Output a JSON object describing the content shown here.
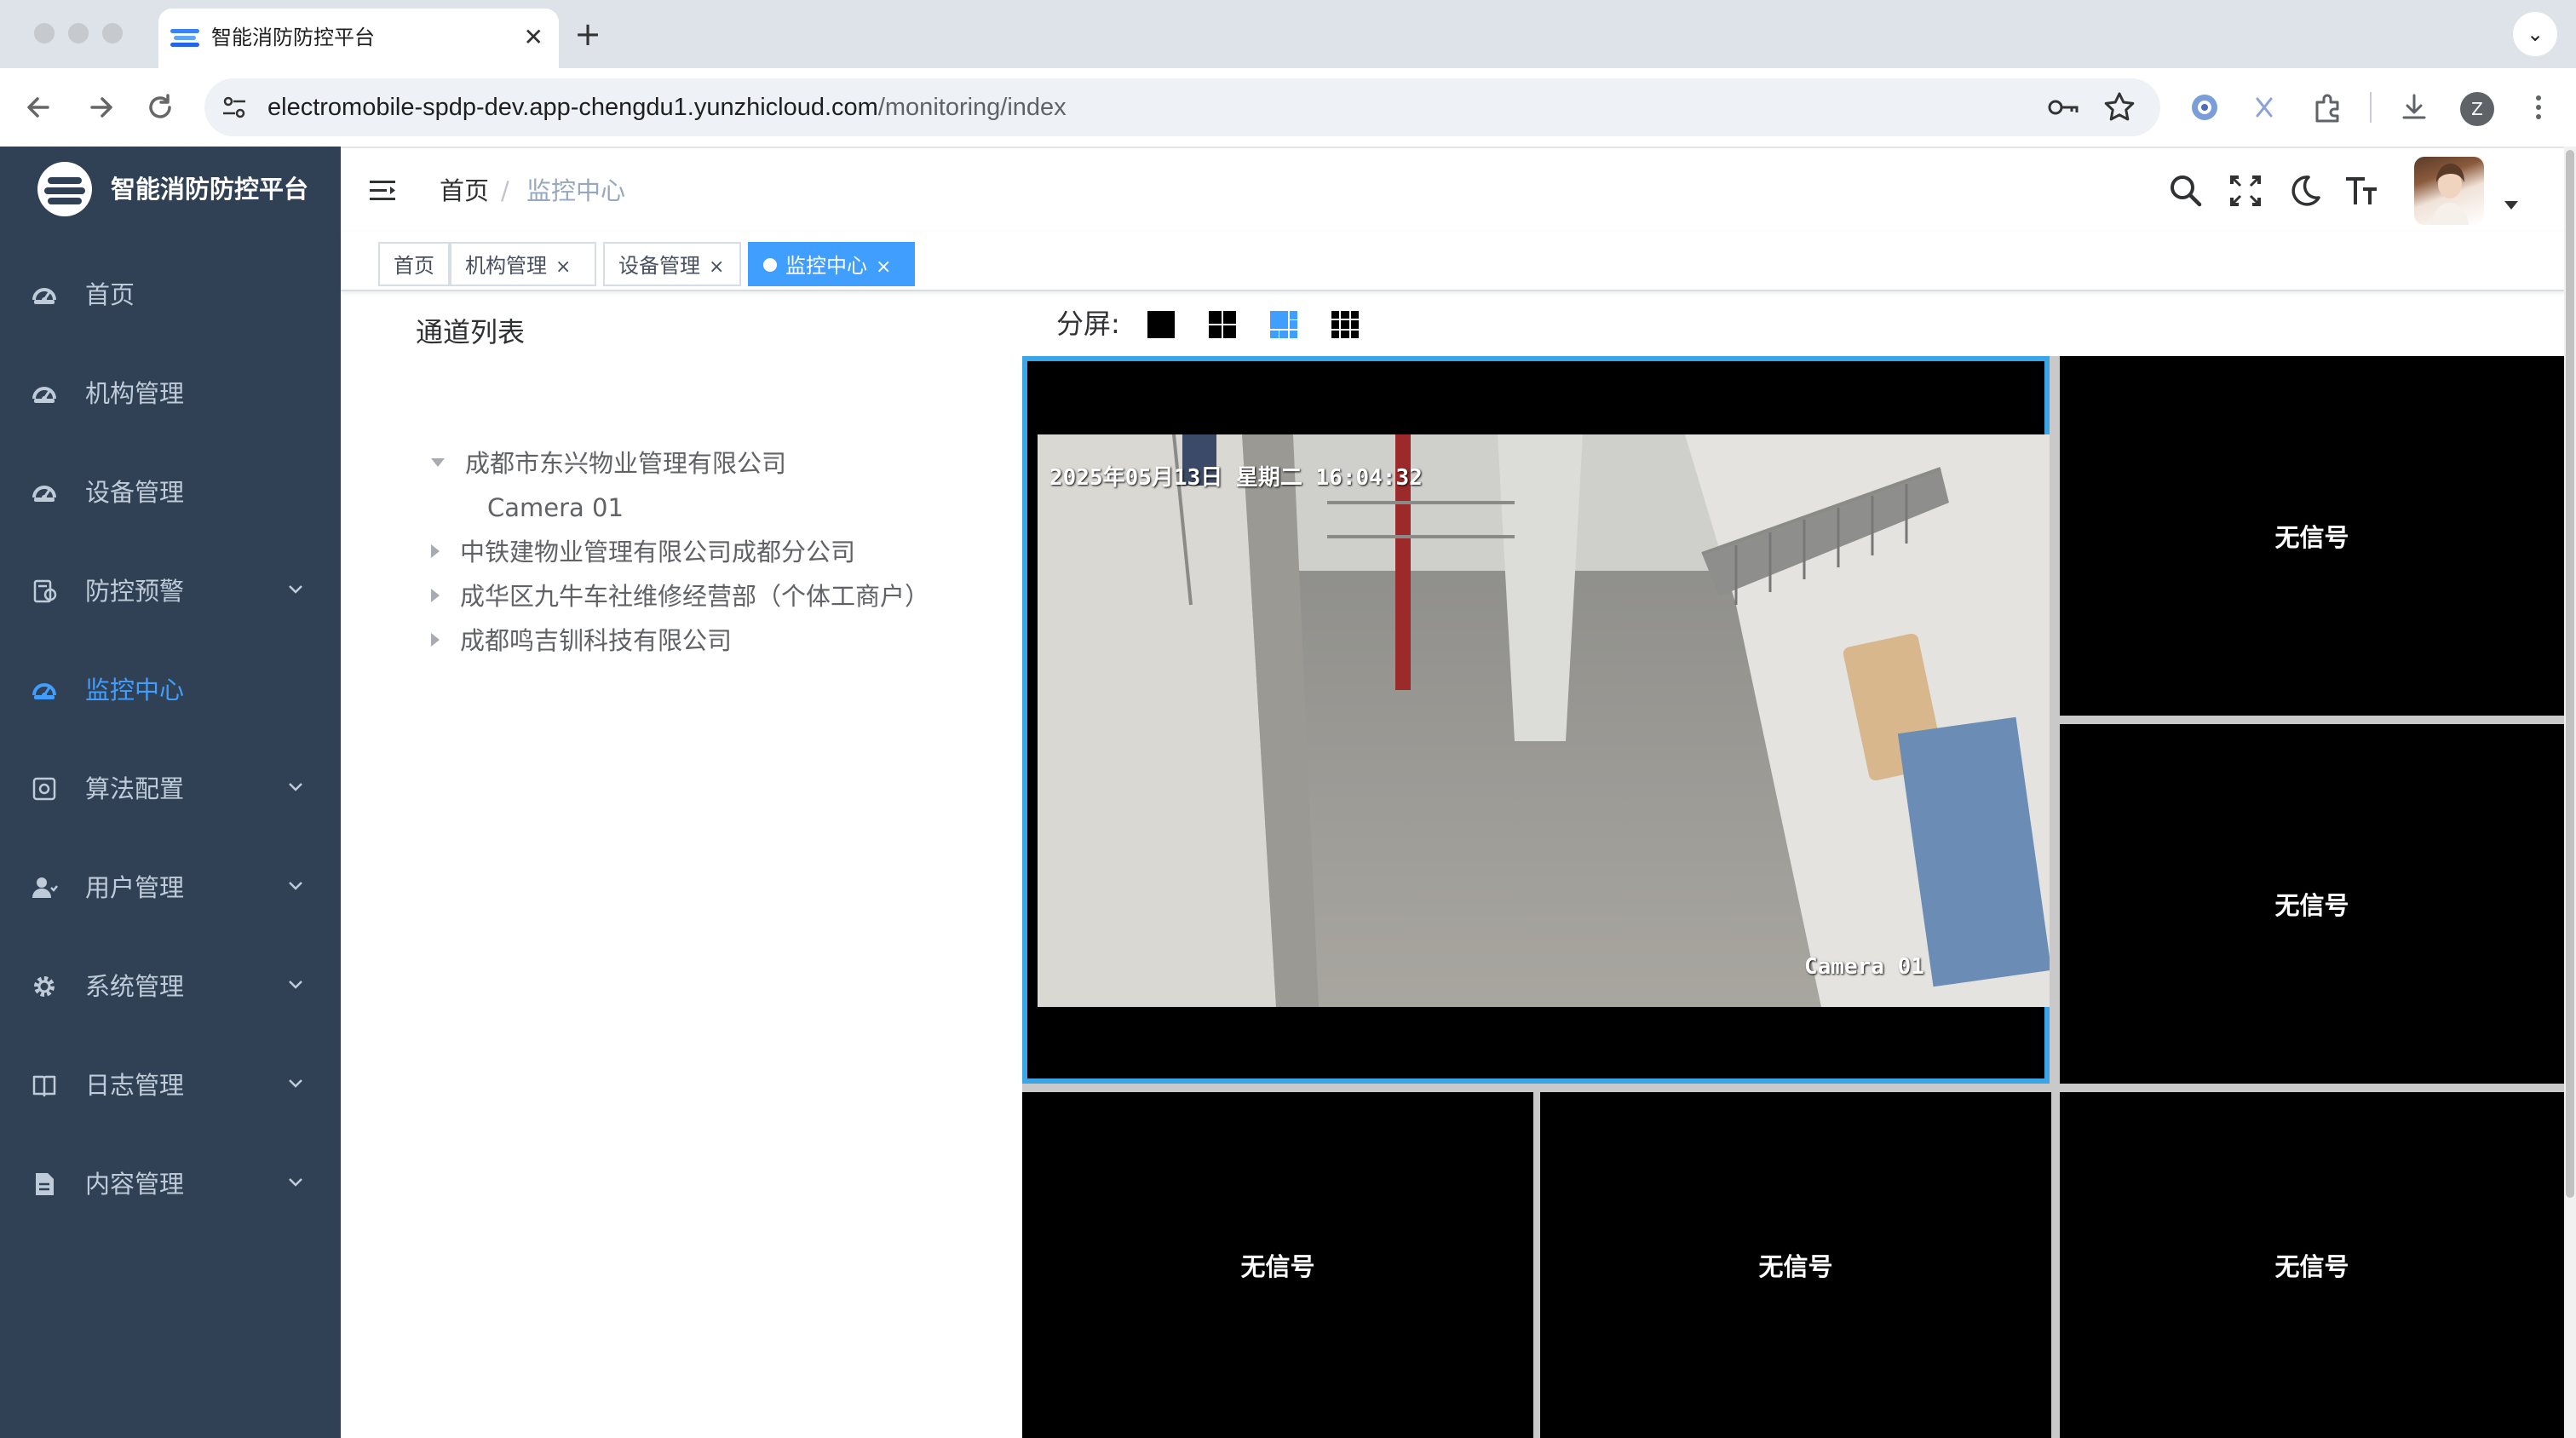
{
  "browser": {
    "tab_title": "智能消防防控平台",
    "tab_close": "✕",
    "new_tab": "+",
    "tab_menu": "⌄",
    "url_host": "electromobile-spdp-dev.app-chengdu1.yunzhicloud.com",
    "url_path": "/monitoring/index",
    "profile_initial": "Z",
    "icons": [
      "back-icon",
      "forward-icon",
      "reload-icon",
      "site-info-icon",
      "password-key-icon",
      "bookmark-star-icon",
      "extension-icon",
      "download-icon",
      "menu-dots-icon"
    ]
  },
  "sidebar": {
    "title": "智能消防防控平台",
    "items": [
      {
        "label": "首页",
        "icon": "dashboard-icon",
        "has_children": false,
        "active": false
      },
      {
        "label": "机构管理",
        "icon": "dashboard-icon",
        "has_children": false,
        "active": false
      },
      {
        "label": "设备管理",
        "icon": "dashboard-icon",
        "has_children": false,
        "active": false
      },
      {
        "label": "防控预警",
        "icon": "alert-icon",
        "has_children": true,
        "active": false
      },
      {
        "label": "监控中心",
        "icon": "dashboard-icon",
        "has_children": false,
        "active": true
      },
      {
        "label": "算法配置",
        "icon": "algorithm-icon",
        "has_children": true,
        "active": false
      },
      {
        "label": "用户管理",
        "icon": "user-icon",
        "has_children": true,
        "active": false
      },
      {
        "label": "系统管理",
        "icon": "gear-icon",
        "has_children": true,
        "active": false
      },
      {
        "label": "日志管理",
        "icon": "book-icon",
        "has_children": true,
        "active": false
      },
      {
        "label": "内容管理",
        "icon": "document-icon",
        "has_children": true,
        "active": false
      }
    ]
  },
  "header": {
    "breadcrumb": [
      "首页",
      "监控中心"
    ],
    "separator": "/"
  },
  "tags": [
    {
      "label": "首页",
      "closable": false,
      "active": false
    },
    {
      "label": "机构管理",
      "closable": true,
      "active": false
    },
    {
      "label": "设备管理",
      "closable": true,
      "active": false
    },
    {
      "label": "监控中心",
      "closable": true,
      "active": true
    }
  ],
  "tag_close": "×",
  "channel_panel": {
    "title": "通道列表",
    "tree": [
      {
        "label": "成都市东兴物业管理有限公司",
        "expanded": true,
        "children": [
          "Camera 01"
        ]
      },
      {
        "label": "中铁建物业管理有限公司成都分公司",
        "expanded": false
      },
      {
        "label": "成华区九牛车社维修经营部（个体工商户）",
        "expanded": false
      },
      {
        "label": "成都鸣吉钏科技有限公司",
        "expanded": false
      }
    ]
  },
  "split_screen": {
    "label": "分屏:",
    "options": [
      "1",
      "4",
      "6",
      "9"
    ],
    "selected": "6"
  },
  "video_grid": {
    "main": {
      "osd_datetime": "2025年05月13日 星期二 16:04:32",
      "osd_camera": "Camera 01"
    },
    "no_signal": "无信号",
    "no_signal_cells": 5
  },
  "colors": {
    "sidebar_bg": "#304156",
    "sidebar_text": "#bfcbd9",
    "active": "#409eff",
    "video_border": "#3aa6e8"
  }
}
